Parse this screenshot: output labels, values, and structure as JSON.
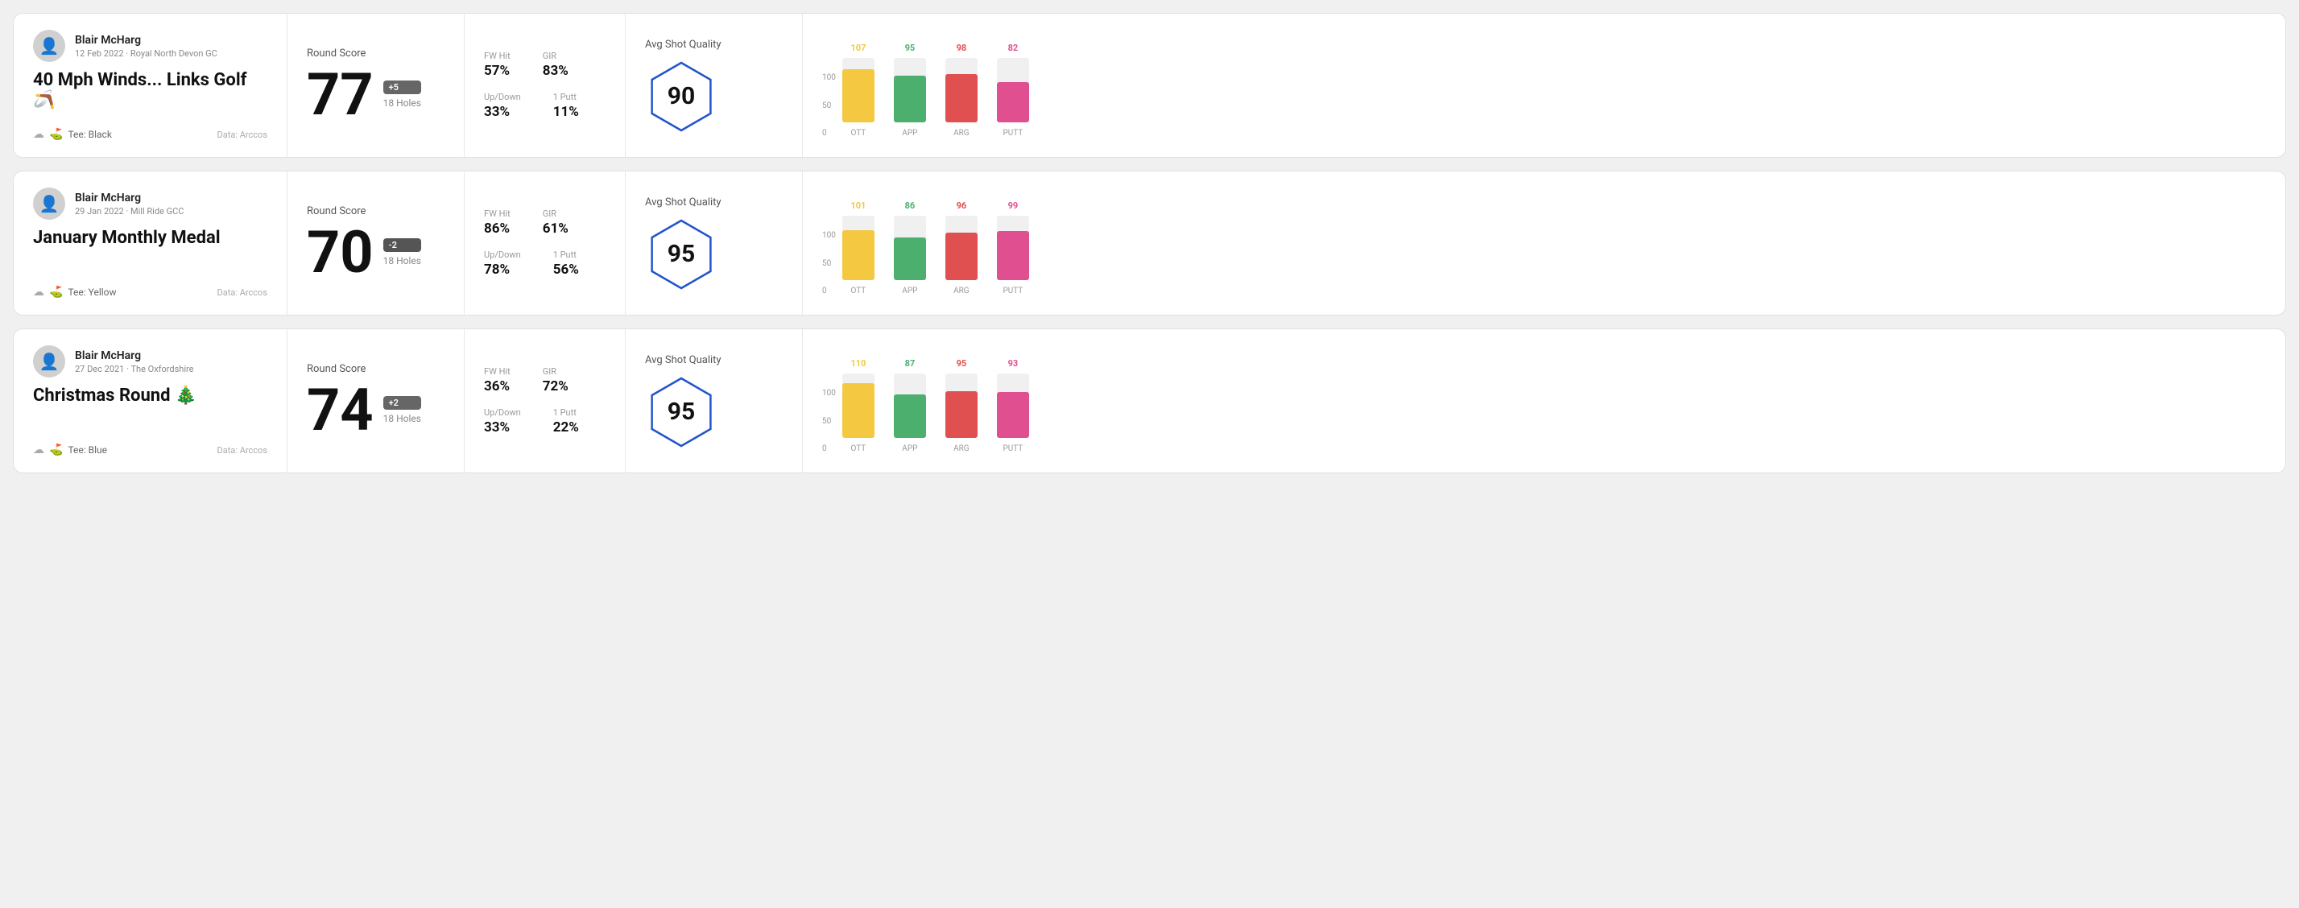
{
  "rounds": [
    {
      "player_name": "Blair McHarg",
      "player_meta": "12 Feb 2022 · Royal North Devon GC",
      "round_title": "40 Mph Winds... Links Golf",
      "round_emoji": "🪃",
      "tee": "Black",
      "data_source": "Data: Arccos",
      "score": "77",
      "score_badge": "+5",
      "score_badge_type": "positive",
      "holes": "18 Holes",
      "fw_hit": "57%",
      "gir": "83%",
      "up_down": "33%",
      "one_putt": "11%",
      "avg_quality": "90",
      "chart": {
        "bars": [
          {
            "label": "OTT",
            "value": 107,
            "max": 130,
            "color_class": "bar-color-ott",
            "label_color": "#f5c842"
          },
          {
            "label": "APP",
            "value": 95,
            "max": 130,
            "color_class": "bar-color-app",
            "label_color": "#4caf6e"
          },
          {
            "label": "ARG",
            "value": 98,
            "max": 130,
            "color_class": "bar-color-arg",
            "label_color": "#e05050"
          },
          {
            "label": "PUTT",
            "value": 82,
            "max": 130,
            "color_class": "bar-color-putt",
            "label_color": "#e05090"
          }
        ]
      }
    },
    {
      "player_name": "Blair McHarg",
      "player_meta": "29 Jan 2022 · Mill Ride GCC",
      "round_title": "January Monthly Medal",
      "round_emoji": "",
      "tee": "Yellow",
      "data_source": "Data: Arccos",
      "score": "70",
      "score_badge": "-2",
      "score_badge_type": "negative",
      "holes": "18 Holes",
      "fw_hit": "86%",
      "gir": "61%",
      "up_down": "78%",
      "one_putt": "56%",
      "avg_quality": "95",
      "chart": {
        "bars": [
          {
            "label": "OTT",
            "value": 101,
            "max": 130,
            "color_class": "bar-color-ott",
            "label_color": "#f5c842"
          },
          {
            "label": "APP",
            "value": 86,
            "max": 130,
            "color_class": "bar-color-app",
            "label_color": "#4caf6e"
          },
          {
            "label": "ARG",
            "value": 96,
            "max": 130,
            "color_class": "bar-color-arg",
            "label_color": "#e05050"
          },
          {
            "label": "PUTT",
            "value": 99,
            "max": 130,
            "color_class": "bar-color-putt",
            "label_color": "#e05090"
          }
        ]
      }
    },
    {
      "player_name": "Blair McHarg",
      "player_meta": "27 Dec 2021 · The Oxfordshire",
      "round_title": "Christmas Round",
      "round_emoji": "🎄",
      "tee": "Blue",
      "data_source": "Data: Arccos",
      "score": "74",
      "score_badge": "+2",
      "score_badge_type": "positive",
      "holes": "18 Holes",
      "fw_hit": "36%",
      "gir": "72%",
      "up_down": "33%",
      "one_putt": "22%",
      "avg_quality": "95",
      "chart": {
        "bars": [
          {
            "label": "OTT",
            "value": 110,
            "max": 130,
            "color_class": "bar-color-ott",
            "label_color": "#f5c842"
          },
          {
            "label": "APP",
            "value": 87,
            "max": 130,
            "color_class": "bar-color-app",
            "label_color": "#4caf6e"
          },
          {
            "label": "ARG",
            "value": 95,
            "max": 130,
            "color_class": "bar-color-arg",
            "label_color": "#e05050"
          },
          {
            "label": "PUTT",
            "value": 93,
            "max": 130,
            "color_class": "bar-color-putt",
            "label_color": "#e05090"
          }
        ]
      }
    }
  ],
  "labels": {
    "round_score": "Round Score",
    "avg_shot_quality": "Avg Shot Quality",
    "fw_hit": "FW Hit",
    "gir": "GIR",
    "up_down": "Up/Down",
    "one_putt": "1 Putt",
    "data_arccos": "Data: Arccos",
    "tee_prefix": "Tee:",
    "y_axis": [
      "100",
      "50",
      "0"
    ]
  }
}
